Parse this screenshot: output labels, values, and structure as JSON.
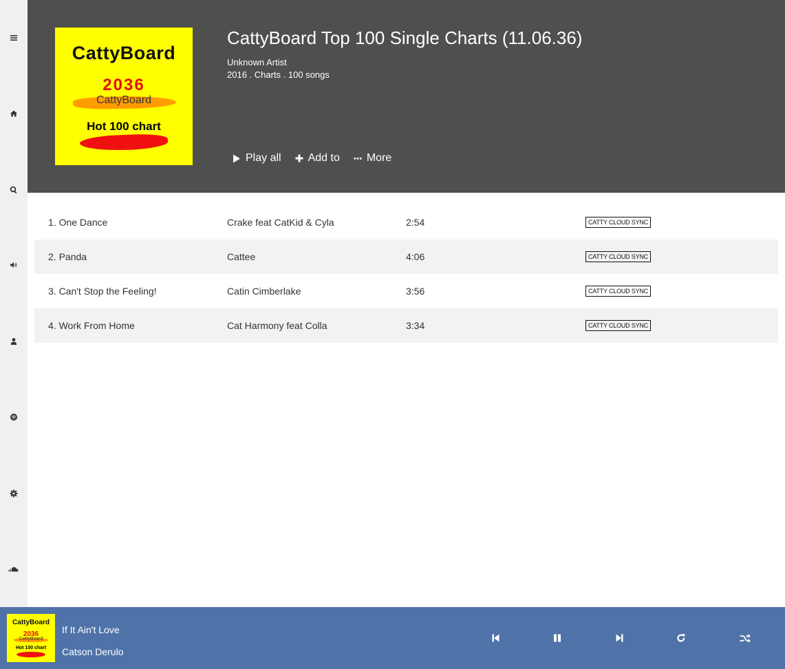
{
  "sidebar": {
    "items": [
      {
        "name": "menu-icon"
      },
      {
        "name": "home-icon"
      },
      {
        "name": "search-icon"
      },
      {
        "name": "volume-icon"
      },
      {
        "name": "user-icon"
      },
      {
        "name": "spotify-icon"
      },
      {
        "name": "gear-icon"
      },
      {
        "name": "soundcloud-icon"
      }
    ]
  },
  "album": {
    "cover": {
      "brand": "CattyBoard",
      "year": "2036",
      "sub": "CattyBoard",
      "hot": "Hot 100 chart"
    },
    "title": "CattyBoard Top 100 Single Charts (11.06.36)",
    "artist": "Unknown Artist",
    "meta": "2016 . Charts . 100 songs",
    "actions": {
      "play_all": "Play all",
      "add_to": "Add to",
      "more": "More"
    }
  },
  "tracks": [
    {
      "title": "1. One Dance",
      "artist": "Crake feat CatKid & Cyla",
      "duration": "2:54",
      "badge": "CATTY CLOUD SYNC"
    },
    {
      "title": "2. Panda",
      "artist": "Cattee",
      "duration": "4:06",
      "badge": "CATTY CLOUD SYNC"
    },
    {
      "title": "3. Can't Stop the Feeling!",
      "artist": "Catin Cimberlake",
      "duration": "3:56",
      "badge": "CATTY CLOUD SYNC"
    },
    {
      "title": "4. Work From Home",
      "artist": "Cat Harmony feat Colla",
      "duration": "3:34",
      "badge": "CATTY CLOUD SYNC"
    }
  ],
  "player": {
    "cover": {
      "brand": "CattyBoard",
      "year": "2036",
      "sub": "CattyBoard",
      "hot": "Hot 100 chart"
    },
    "title": "If It Ain't Love",
    "artist": "Catson Derulo",
    "controls": [
      "previous-icon",
      "pause-icon",
      "next-icon",
      "repeat-icon",
      "shuffle-icon"
    ]
  },
  "colors": {
    "sidebar_bg": "#f0f0f0",
    "header_bg": "#4f4f4f",
    "player_bg": "#4f73a8",
    "row_alt_bg": "#f2f2f2",
    "cover_bg": "#ffff00"
  }
}
